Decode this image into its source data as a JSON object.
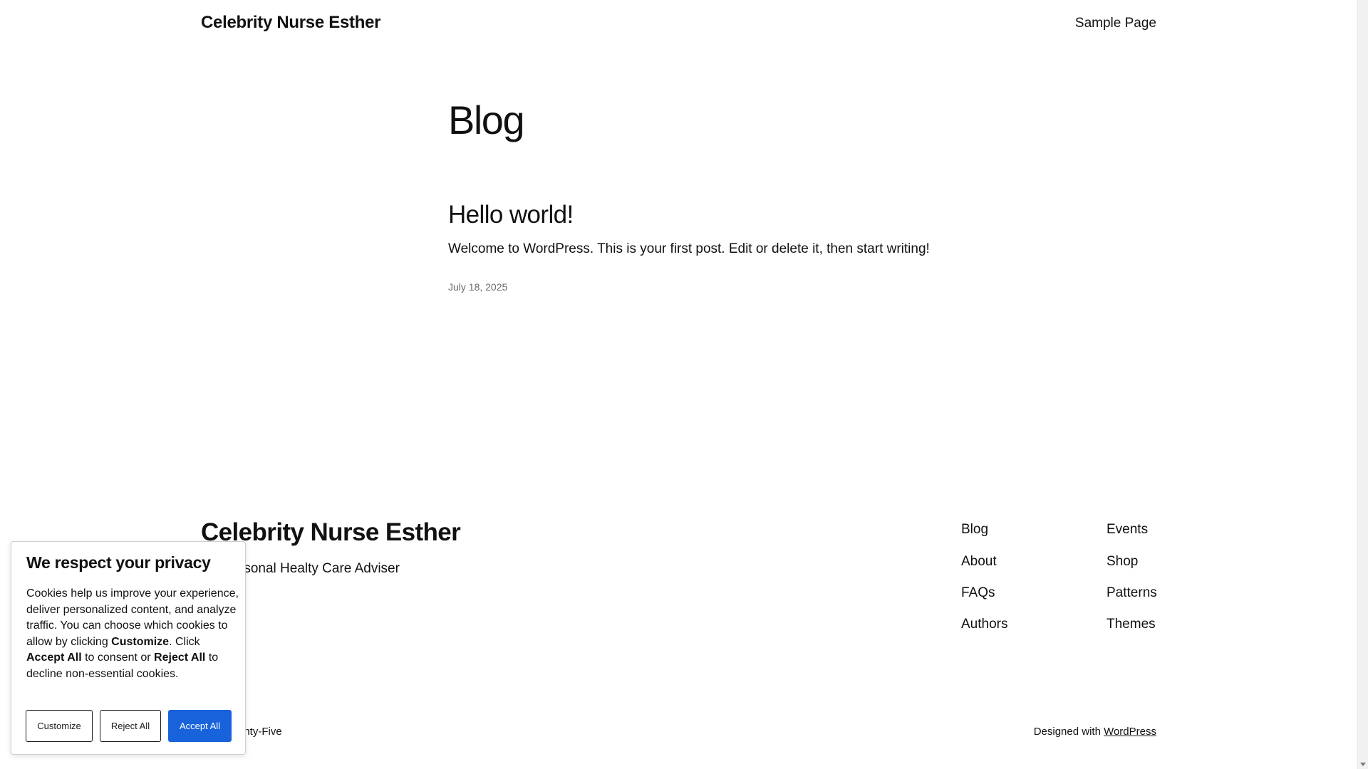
{
  "header": {
    "site_title": "Celebrity Nurse Esther",
    "nav_item": "Sample Page"
  },
  "main": {
    "heading": "Blog",
    "post": {
      "title": "Hello world!",
      "excerpt": "Welcome to WordPress. This is your first post. Edit or delete it, then start writing!",
      "date": "July 18, 2025"
    }
  },
  "footer": {
    "site_title": "Celebrity Nurse Esther",
    "tagline_visible": "rsonal Healty Care Adviser",
    "nav_col1": [
      "Blog",
      "About",
      "FAQs",
      "Authors"
    ],
    "nav_col2": [
      "Events",
      "Shop",
      "Patterns",
      "Themes"
    ],
    "bottom_left_visible": "enty-Five",
    "designed_with": "Designed with",
    "wordpress_link": "WordPress"
  },
  "cookie_banner": {
    "title": "We respect your privacy",
    "text_1": "Cookies help us improve your experience, deliver personalized content, and analyze traffic. You can choose which cookies to allow by clicking ",
    "bold_customize": "Customize",
    "text_2": ". Click ",
    "bold_accept": "Accept All",
    "text_3": " to consent or ",
    "bold_reject": "Reject All",
    "text_4": " to decline non-essential cookies.",
    "buttons": {
      "customize": "Customize",
      "reject": "Reject All",
      "accept": "Accept All"
    }
  },
  "colors": {
    "accept_button": "#1863dc",
    "text": "#111111",
    "muted": "#6b6b6b"
  }
}
